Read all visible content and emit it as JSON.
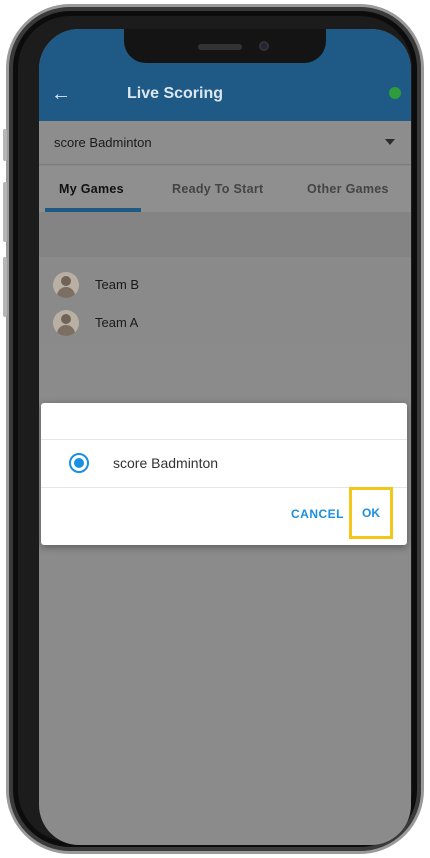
{
  "appbar": {
    "title": "Live Scoring",
    "back_icon": "arrow-left-icon",
    "status_color": "#2e9c3a"
  },
  "select": {
    "value": "score Badminton"
  },
  "tabs": [
    {
      "label": "My Games",
      "active": true
    },
    {
      "label": "Ready To Start",
      "active": false
    },
    {
      "label": "Other Games",
      "active": false
    }
  ],
  "game": {
    "teams": [
      "Team B",
      "Team A"
    ]
  },
  "dialog": {
    "options": [
      {
        "label": "score Badminton",
        "selected": true
      }
    ],
    "cancel_label": "CANCEL",
    "ok_label": "OK"
  },
  "colors": {
    "appbar": "#1f5a86",
    "accent": "#1b8fe0",
    "highlight": "#f2c719"
  }
}
